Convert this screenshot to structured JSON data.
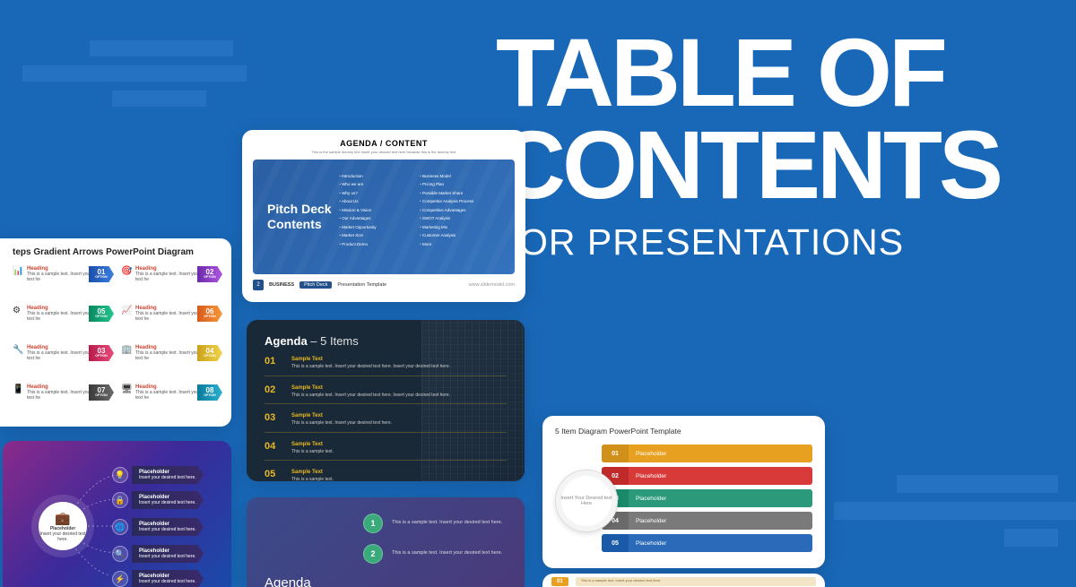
{
  "hero": {
    "line1": "TABLE OF",
    "line2": "CONTENTS",
    "sub": "FOR PRESENTATIONS"
  },
  "card1": {
    "header": "AGENDA / CONTENT",
    "subheader": "This is the sample dummy text insert your desired text here because this is the dummy text",
    "pitchTitle": "Pitch Deck Contents",
    "col1": [
      "Introduction",
      "Who we are",
      "Why us?",
      "About Us",
      "Mission & Vision",
      "Our Advantages",
      "Market Opportunity",
      "Market Size",
      "Product Demo"
    ],
    "col2": [
      "Business Model",
      "Pricing Plan",
      "Possible Market Share",
      "Competitor Analysis Process",
      "Competitive Advantages",
      "SWOT Analysis",
      "Marketing Mix",
      "Customer Analysis",
      "More"
    ],
    "footer": {
      "page": "2",
      "brand": "BUSINESS",
      "pitch": "Pitch Deck",
      "tmpl": "Presentation Template",
      "site": "www.slidemodel.com"
    }
  },
  "card2": {
    "title": "teps Gradient Arrows PowerPoint Diagram",
    "heading": "Heading",
    "sample": "This is a sample text. Insert your desired text here. This is a sample text",
    "nums": [
      "01",
      "02",
      "05",
      "06",
      "03",
      "04",
      "07",
      "08"
    ],
    "option": "OPTION"
  },
  "card3": {
    "title_b": "Agenda",
    "title_s": " – 5 Items",
    "items": [
      {
        "n": "01",
        "h": "Sample Text",
        "t": "This is a sample text. Insert your desired text here. Insert your desired text here."
      },
      {
        "n": "02",
        "h": "Sample Text",
        "t": "This is a sample text. Insert your desired text here. Insert your desired text here."
      },
      {
        "n": "03",
        "h": "Sample Text",
        "t": "This is a sample text. Insert your desired text here."
      },
      {
        "n": "04",
        "h": "Sample Text",
        "t": "This is a sample text."
      },
      {
        "n": "05",
        "h": "Sample Text",
        "t": "This is a sample text."
      }
    ]
  },
  "card4": {
    "hub": "Placeholder",
    "hubsub": "Insert your desired text here.",
    "nodes": [
      {
        "label": "Placeholder",
        "sub": "Insert your desired text here."
      },
      {
        "label": "Placeholder",
        "sub": "Insert your desired text here."
      },
      {
        "label": "Placeholder",
        "sub": "Insert your desired text here."
      },
      {
        "label": "Placeholder",
        "sub": "Insert your desired text here."
      },
      {
        "label": "Placeholder",
        "sub": "Insert your desired text here."
      }
    ]
  },
  "card5": {
    "title": "5 Item Diagram PowerPoint Template",
    "circle": "Insert Your Desired text Here",
    "bars": [
      {
        "n": "01",
        "t": "Placeholder"
      },
      {
        "n": "02",
        "t": "Placeholder"
      },
      {
        "n": "03",
        "t": "Placeholder"
      },
      {
        "n": "04",
        "t": "Placeholder"
      },
      {
        "n": "05",
        "t": "Placeholder"
      }
    ]
  },
  "card6": {
    "title": "Agenda",
    "rows": [
      {
        "n": "1",
        "t": "This is a sample text. Insert your desired text here."
      },
      {
        "n": "2",
        "t": "This is a sample text. Insert your desired text here."
      }
    ]
  },
  "card7": {
    "n": "01",
    "t": "This is a sample text. Insert your desired text here."
  }
}
